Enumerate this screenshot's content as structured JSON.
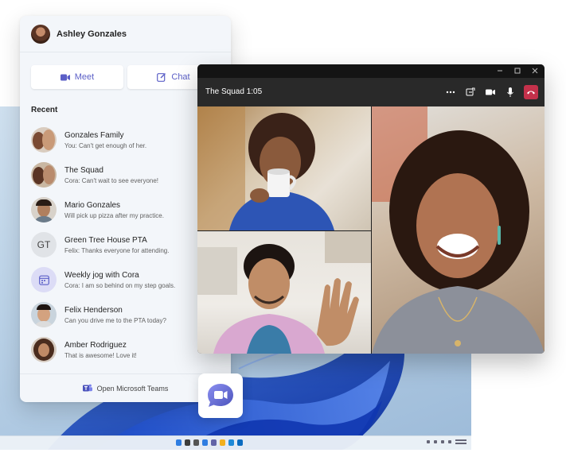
{
  "flyout": {
    "user_name": "Ashley Gonzales",
    "meet_label": "Meet",
    "chat_label": "Chat",
    "recent_label": "Recent",
    "footer_label": "Open Microsoft Teams",
    "items": [
      {
        "name": "Gonzales Family",
        "preview": "You: Can't get enough of her."
      },
      {
        "name": "The Squad",
        "preview": "Cora: Can't wait to see everyone!"
      },
      {
        "name": "Mario Gonzales",
        "preview": "Will pick up pizza after my practice."
      },
      {
        "name": "Green Tree House PTA",
        "preview": "Felix: Thanks everyone for attending.",
        "initials": "GT"
      },
      {
        "name": "Weekly jog with Cora",
        "preview": "Cora: I am so behind on my step goals."
      },
      {
        "name": "Felix Henderson",
        "preview": "Can you drive me to the PTA today?"
      },
      {
        "name": "Amber Rodriguez",
        "preview": "That is awesome! Love it!"
      }
    ]
  },
  "call": {
    "title": "The Squad 1:05"
  },
  "icons": {
    "meet": "video-camera-icon",
    "chat": "compose-icon",
    "teams": "teams-logo-icon",
    "hangup": "hang-up-icon"
  },
  "colors": {
    "accent": "#5b5fc7",
    "hangup": "#c4314b",
    "call_bar": "#292929"
  }
}
